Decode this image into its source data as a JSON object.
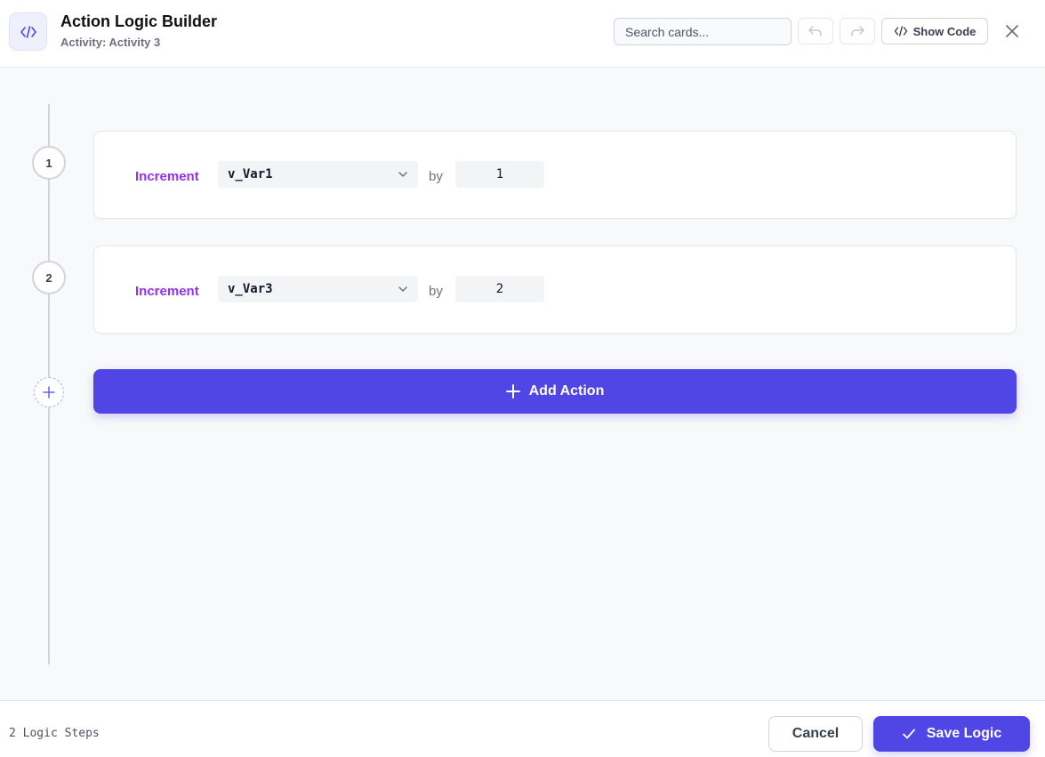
{
  "header": {
    "title": "Action Logic Builder",
    "subtitle": "Activity: Activity 3",
    "search_placeholder": "Search cards...",
    "show_code_label": "Show Code",
    "icons": {
      "app": "code-icon",
      "undo": "undo-icon",
      "redo": "redo-icon",
      "show_code": "code-icon",
      "close": "close-icon"
    }
  },
  "steps": [
    {
      "number": "1",
      "keyword": "Increment",
      "variable": "v_Var1",
      "connector": "by",
      "amount": "1"
    },
    {
      "number": "2",
      "keyword": "Increment",
      "variable": "v_Var3",
      "connector": "by",
      "amount": "2"
    }
  ],
  "add_action_label": "Add Action",
  "footer": {
    "step_count": "2 Logic Steps",
    "cancel_label": "Cancel",
    "save_label": "Save Logic"
  },
  "colors": {
    "accent": "#4f46e5",
    "keyword": "#9333ea",
    "background": "#f8f9fb"
  }
}
